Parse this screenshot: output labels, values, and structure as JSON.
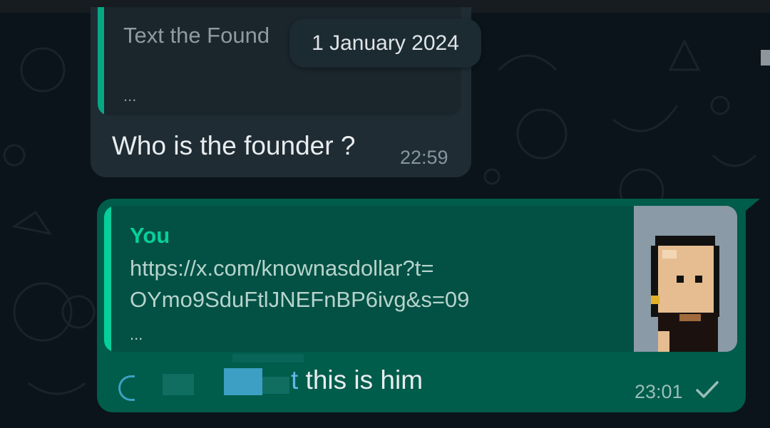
{
  "date_divider": "1 January 2024",
  "incoming": {
    "quote_text": "Text the Found",
    "quote_more": "...",
    "message": "Who is the founder ?",
    "time": "22:59"
  },
  "outgoing": {
    "quote_author": "You",
    "quote_line1": "https://x.com/knownasdollar?t=",
    "quote_line2": "OYmo9SduFtlJNEFnBP6ivg&s=09",
    "quote_more": "...",
    "message_partial": "t",
    "message": " this is him",
    "time": "23:01",
    "status_icon": "single-check-icon"
  },
  "colors": {
    "background": "#0b141a",
    "incoming_bubble": "#1f2c34",
    "outgoing_bubble": "#005c4b",
    "accent": "#06cf9c"
  }
}
